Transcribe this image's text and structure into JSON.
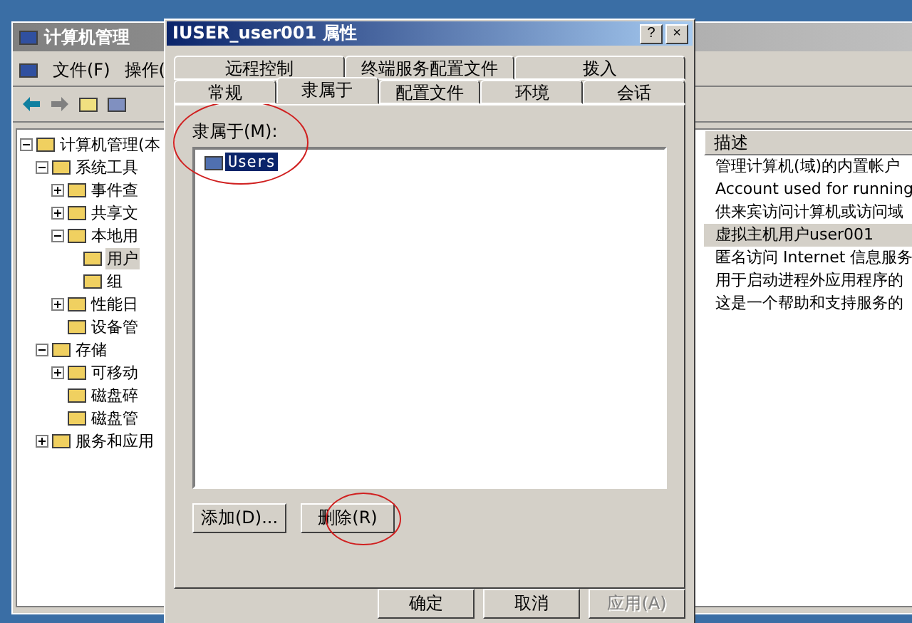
{
  "main_window": {
    "title": "计算机管理",
    "menu": [
      "文件(F)",
      "操作("
    ],
    "tree": [
      {
        "label": "计算机管理(本",
        "selected": false,
        "expanded": true,
        "children": [
          {
            "label": "系统工具",
            "selected": false,
            "expanded": true,
            "children": [
              {
                "label": "事件查",
                "selected": false,
                "expanded": false
              },
              {
                "label": "共享文",
                "selected": false,
                "expanded": false
              },
              {
                "label": "本地用",
                "selected": false,
                "expanded": true,
                "children": [
                  {
                    "label": "用户",
                    "selected": true
                  },
                  {
                    "label": "组",
                    "selected": false
                  }
                ]
              },
              {
                "label": "性能日",
                "selected": false,
                "expanded": false
              },
              {
                "label": "设备管",
                "selected": false
              }
            ]
          },
          {
            "label": "存储",
            "selected": false,
            "expanded": true,
            "children": [
              {
                "label": "可移动",
                "selected": false,
                "expanded": false
              },
              {
                "label": "磁盘碎",
                "selected": false
              },
              {
                "label": "磁盘管",
                "selected": false
              }
            ]
          },
          {
            "label": "服务和应用",
            "selected": false,
            "expanded": false
          }
        ]
      }
    ],
    "list_header": "描述",
    "list_rows": [
      {
        "text": "管理计算机(域)的内置帐户",
        "selected": false
      },
      {
        "text": "Account used for running",
        "selected": false
      },
      {
        "text": "供来宾访问计算机或访问域",
        "selected": false
      },
      {
        "text": "虚拟主机用户user001",
        "selected": true
      },
      {
        "text": "匿名访问 Internet 信息服务",
        "selected": false
      },
      {
        "text": "用于启动进程外应用程序的",
        "selected": false
      },
      {
        "text": "这是一个帮助和支持服务的",
        "selected": false
      }
    ]
  },
  "dialog": {
    "title": "IUSER_user001 属性",
    "help": "?",
    "close": "×",
    "tabs_back": [
      {
        "label": "远程控制",
        "selected": false
      },
      {
        "label": "终端服务配置文件",
        "selected": false
      },
      {
        "label": "拨入",
        "selected": false
      }
    ],
    "tabs_front": [
      {
        "label": "常规",
        "selected": false
      },
      {
        "label": "隶属于",
        "selected": true
      },
      {
        "label": "配置文件",
        "selected": false
      },
      {
        "label": "环境",
        "selected": false
      },
      {
        "label": "会话",
        "selected": false
      }
    ],
    "member_label": "隶属于(M):",
    "members": [
      {
        "name": "Users",
        "selected": true
      }
    ],
    "buttons": [
      {
        "label": "添加(D)...",
        "disabled": false
      },
      {
        "label": "删除(R)",
        "disabled": false
      }
    ],
    "footer": [
      {
        "label": "确定",
        "disabled": false
      },
      {
        "label": "取消",
        "disabled": false
      },
      {
        "label": "应用(A)",
        "disabled": true
      }
    ]
  }
}
